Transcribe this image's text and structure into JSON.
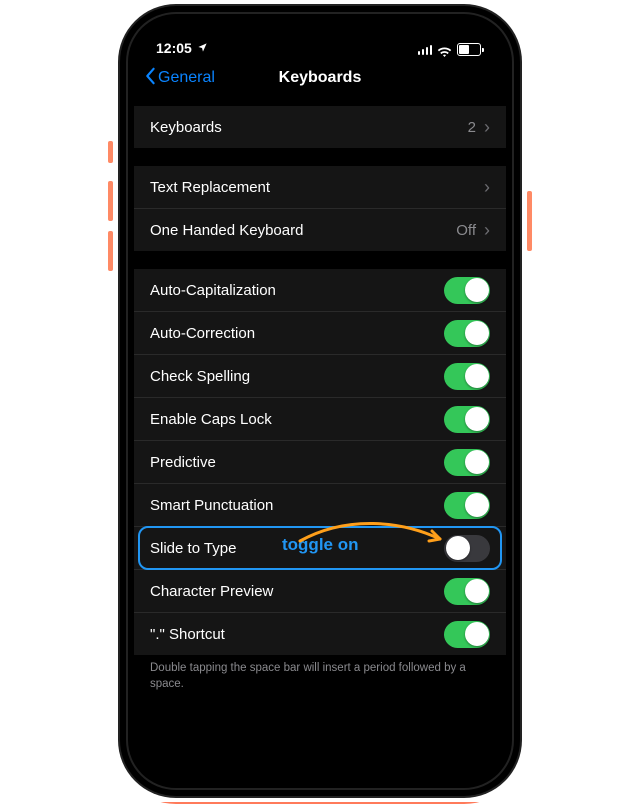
{
  "status": {
    "time": "12:05"
  },
  "nav": {
    "back": "General",
    "title": "Keyboards"
  },
  "rows": {
    "keyboards": {
      "label": "Keyboards",
      "count": "2"
    },
    "textReplacement": {
      "label": "Text Replacement"
    },
    "oneHanded": {
      "label": "One Handed Keyboard",
      "value": "Off"
    },
    "autoCap": {
      "label": "Auto-Capitalization",
      "on": true
    },
    "autoCorrect": {
      "label": "Auto-Correction",
      "on": true
    },
    "checkSpelling": {
      "label": "Check Spelling",
      "on": true
    },
    "capsLock": {
      "label": "Enable Caps Lock",
      "on": true
    },
    "predictive": {
      "label": "Predictive",
      "on": true
    },
    "smartPunct": {
      "label": "Smart Punctuation",
      "on": true
    },
    "slideToType": {
      "label": "Slide to Type",
      "on": false
    },
    "charPreview": {
      "label": "Character Preview",
      "on": true
    },
    "periodShortcut": {
      "label": "\".\" Shortcut",
      "on": true
    }
  },
  "footer": "Double tapping the space bar will insert a period followed by a space.",
  "annotation": {
    "text": "toggle on"
  }
}
